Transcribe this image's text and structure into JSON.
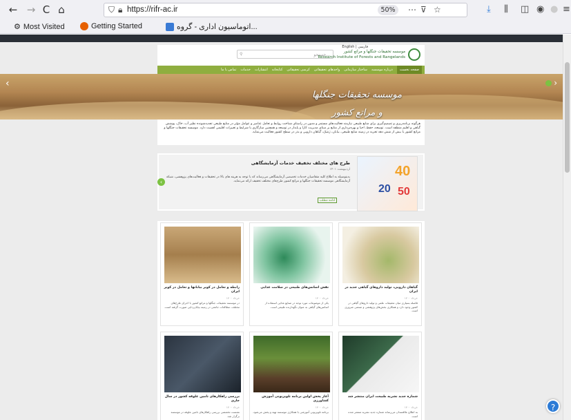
{
  "browser": {
    "url": "https://rifr-ac.ir",
    "zoom": "50%",
    "nav": {
      "back": "←",
      "forward": "→",
      "reload": "C",
      "home": "⌂"
    },
    "bookmarks": [
      {
        "label": "Most Visited"
      },
      {
        "label": "Getting Started"
      },
      {
        "label": "اتوماسیون اداری - گروه..."
      }
    ]
  },
  "site": {
    "english_link": "English | فارسی",
    "logo_line1": "موسسه تحقیقات جنگلها و مراتع کشور",
    "logo_line2": "Research Institute of Forests and Rangelands",
    "search_placeholder": "جستجو...",
    "nav_items": [
      "صفحه نخست",
      "درباره موسسه",
      "ساختار سازمانی",
      "واحدهای تحقیقاتی",
      "کرسی تحقیقاتی",
      "کتابخانه",
      "انتشارات",
      "خدمات",
      "تماس با ما"
    ],
    "banner_title": "موسسه تحقیقات جنگلها و مراتع کشور",
    "intro": "هرگونه برنامه‌ریزی و تصمیم‌گیری برای منابع طبیعی نیازمند فعالیت‌های مستمر و مدون در راستای شناخت روابط و تعامل عناصر و عوامل مؤثر در منابع طبیعی تجدیدشونده نظیر آب، خاک، پوشش گیاهی و اقلیم منطقه است. توسعه، حفظ، احیا و بهره‌برداری از منابع بر مبنای مدیریت کارا و پایدار در توسعه و همچنین سازگاری با شرایط و تغییرات اقلیمی اهمیت دارد. موسسه تحقیقات جنگلها و مراتع کشور با بیش از شش دهه تجربه در زمینه منابع طبیعی، بیابان، ژنتیک، گیاهان دارویی و بذر در سطح کشور فعالیت می‌نماید.",
    "feature": {
      "title": "طرح های مختلف تخفیف خدمات آزمایشگاهی",
      "date": "اردیبهشت ۱۴۰۱",
      "body": "بدینوسیله به اطلاع کلیه متقاضیان خدمات تخصصی آزمایشگاهی می‌رساند که با توجه به هزینه های بالا در تحقیقات و فعالیت‌های پژوهشی، شبکه آزمایشگاهی موسسه تحقیقات جنگلها و مراتع کشور طرح‌های مختلف تخفیف ارائه می‌نماید.",
      "more": "ادامه مطلب",
      "image_numbers": [
        "40",
        "20",
        "50"
      ]
    },
    "cards": [
      {
        "title": "گیاهان دارویی، تولید داروهای گیاهی جدید در ایران",
        "date": "۱۴۰۰ خرداد",
        "body": "فاصله بسیاری میان تحقیقات علمی و تولید داروهای گیاهی در کشور وجود دارد و همکاری بخش‌های پژوهشی و صنعتی ضروری است."
      },
      {
        "title": "نقش اسانس‌های طبیعی در سلامت غذایی",
        "date": "۱۴۰۰ خرداد",
        "body": "یکی از موضوعات مورد توجه در صنایع غذایی استفاده از اسانس‌های گیاهی به عنوان نگهدارنده طبیعی است."
      },
      {
        "title": "رابطه و تعامل در کویر بیابانها و تعامل در کویر ایران",
        "date": "۱۴۰۰ خرداد",
        "body": "در موسسه تحقیقات جنگلها و مراتع کشور با اجرای طرح‌های مختلف، مطالعات جامعی در زمینه بیابان‌زدایی صورت گرفته است."
      },
      {
        "title": "شماره جدید نشریه طبیعت ایران منتشر شد",
        "date": "۱۴۰۰ خرداد",
        "body": "به اطلاع علاقمندان می‌رساند شماره جدید نشریه منتشر شده است."
      },
      {
        "title": "آغاز پخش اولین برنامه تلویزیونی آموزش کشاورزی",
        "date": "۱۴۰۰ خرداد",
        "body": "برنامه تلویزیونی آموزشی با همکاری موسسه تهیه و پخش می‌شود."
      },
      {
        "title": "بررسی راهکارهای تامین علوفه کشور در سال جاری",
        "date": "۱۴۰۰ خرداد",
        "body": "نشست تخصصی بررسی راهکارهای تامین علوفه در موسسه برگزار شد."
      }
    ]
  }
}
